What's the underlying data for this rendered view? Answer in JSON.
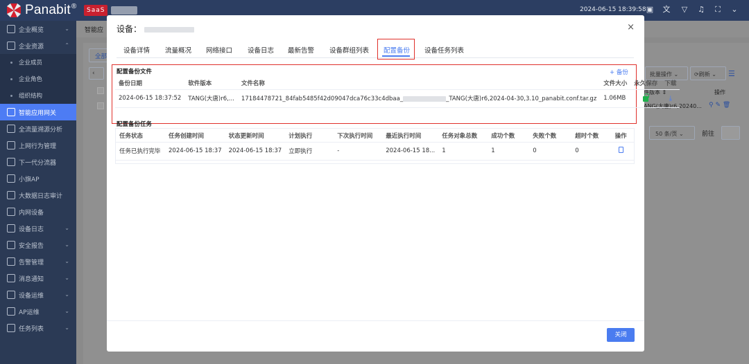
{
  "topbar": {
    "logo_text": "Panabit",
    "logo_reg": "®",
    "saas_badge": "SaaS",
    "datetime": "2024-06-15 18:39:58",
    "icons": [
      "clipboard-icon",
      "translate-icon",
      "shirt-icon",
      "bell-icon",
      "fullscreen-icon",
      "chevron-down-icon"
    ]
  },
  "sidebar": {
    "items": [
      {
        "label": "企业概览",
        "icon": "globe-icon",
        "chev": "⌄"
      },
      {
        "label": "企业资源",
        "icon": "building-icon",
        "chev": "⌃"
      },
      {
        "label": "企业成员",
        "sub": true
      },
      {
        "label": "企业角色",
        "sub": true
      },
      {
        "label": "组织结构",
        "sub": true
      },
      {
        "label": "智能应用网关",
        "icon": "monitor-icon",
        "active": true
      },
      {
        "label": "全流量溯源分析",
        "icon": "monitor-icon"
      },
      {
        "label": "上网行为管理",
        "icon": "monitor-icon"
      },
      {
        "label": "下一代分流器",
        "icon": "monitor-icon"
      },
      {
        "label": "小旗AP",
        "icon": "ap-icon"
      },
      {
        "label": "大数据日志审计",
        "icon": "monitor-icon"
      },
      {
        "label": "内网设备",
        "icon": "monitor-icon"
      },
      {
        "label": "设备日志",
        "icon": "log-icon",
        "chev": "⌄"
      },
      {
        "label": "安全报告",
        "icon": "report-icon",
        "chev": "⌄"
      },
      {
        "label": "告警管理",
        "icon": "bell-icon",
        "chev": "⌄"
      },
      {
        "label": "消息通知",
        "icon": "mail-icon",
        "chev": "⌄"
      },
      {
        "label": "设备运维",
        "icon": "monitor-icon",
        "chev": "⌄"
      },
      {
        "label": "AP运维",
        "icon": "ap-icon",
        "chev": "⌄"
      },
      {
        "label": "任务列表",
        "icon": "list-icon",
        "chev": "⌄"
      }
    ]
  },
  "background": {
    "tab_label": "智能应",
    "filter_label": "全部",
    "batch_label": "批量操作",
    "refresh_label": "刷新",
    "col_version": "件版本",
    "col_ops": "操作",
    "row_version": "ANG(大唐)r6,20240...",
    "page_size": "50 条/页",
    "goto_label": "前往"
  },
  "modal": {
    "title_prefix": "设备：",
    "tabs": [
      "设备详情",
      "流量概况",
      "网络接口",
      "设备日志",
      "最新告警",
      "设备群组列表",
      "配置备份",
      "设备任务列表"
    ],
    "active_tab": "配置备份",
    "close_label": "关闭",
    "backup_files": {
      "title": "配置备份文件",
      "add_label": "+ 备份",
      "columns": [
        "备份日期",
        "软件版本",
        "文件名称",
        "文件大小",
        "永久保存",
        "下载"
      ],
      "rows": [
        {
          "date": "2024-06-15 18:37:52",
          "version": "TANG(大唐)r6,...",
          "filename_a": "17184478721_84fab5485f42d09047dca76c33c4dbaa_",
          "filename_b": "_TANG(大唐)r6,2024-04-30,3.10_panabit.conf.tar.gz",
          "size": "1.06MB"
        }
      ]
    },
    "backup_tasks": {
      "title": "配置备份任务",
      "columns": [
        "任务状态",
        "任务创建时间",
        "状态更新时间",
        "计划执行",
        "下次执行时间",
        "最近执行时间",
        "任务对象总数",
        "成功个数",
        "失败个数",
        "超时个数",
        "操作"
      ],
      "rows": [
        {
          "status": "任务已执行完毕",
          "created": "2024-06-15 18:37",
          "updated": "2024-06-15 18:37",
          "plan": "立即执行",
          "next": "-",
          "last": "2024-06-15 18...",
          "total": "1",
          "success": "1",
          "fail": "0",
          "timeout": "0"
        }
      ]
    }
  },
  "colors": {
    "accent": "#4a7cf0",
    "highlight": "#e0302a",
    "sidebar": "#2b3a55",
    "topbar": "#2c3e62"
  }
}
